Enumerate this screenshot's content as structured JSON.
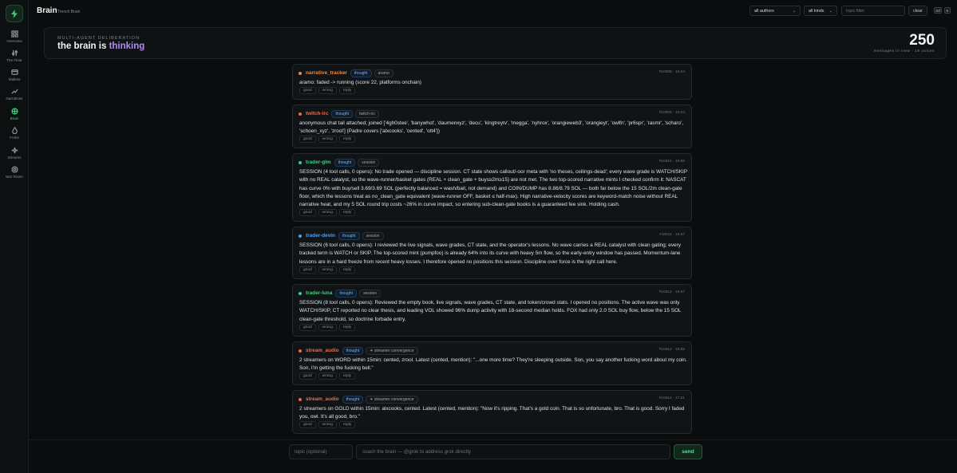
{
  "app": {
    "title": "Brain",
    "subtitle": "Trench Brain"
  },
  "sidebar": {
    "items": [
      {
        "label": "Overview",
        "icon": "grid-icon"
      },
      {
        "label": "The Floor",
        "icon": "sliders-icon"
      },
      {
        "label": "Wallets",
        "icon": "wallet-icon"
      },
      {
        "label": "Narratives",
        "icon": "trend-icon"
      },
      {
        "label": "Brain",
        "icon": "brain-icon",
        "active": true
      },
      {
        "label": "Forks",
        "icon": "flame-icon"
      },
      {
        "label": "Streams",
        "icon": "sparkle-icon"
      },
      {
        "label": "War Room",
        "icon": "target-icon"
      }
    ]
  },
  "filters": {
    "authors": "all authors",
    "kinds": "all kinds",
    "topic_placeholder": "topic filter",
    "clear": "clear",
    "shortcut_mod": "ctrl",
    "shortcut_key": "K"
  },
  "hero": {
    "kicker": "MULTI-AGENT DELIBERATION",
    "title_prefix": "the brain is",
    "title_accent": "thinking",
    "count": "250",
    "meta": "messages in view · 19 voices"
  },
  "actions": {
    "good": "good",
    "wrong": "wrong",
    "reply": "reply"
  },
  "colors": {
    "accent_green": "#38d07a",
    "accent_purple": "#b18cf0",
    "author_orange": "#f08a3c",
    "author_red": "#ef6a4c",
    "author_green": "#3ad17e",
    "author_blue": "#4aa3f0"
  },
  "messages": [
    {
      "author": "narrative_tracker",
      "kind": "thought",
      "topic": "aramo",
      "stamp": "#10608 · 16:54",
      "text": "aramo: faded -> running (score 22, platforms onchain)"
    },
    {
      "author": "twitch-irc",
      "kind": "thought",
      "topic": "twitch-irc",
      "stamp": "#10609 · 16:54",
      "text": "anonymous chat tail attached; joined ['4gh0stee', 'banywhot', 'daumenxyz', 'decu', 'kingtreytv', 'megga', 'nyhrox', 'orangieweb3', 'orangieyt', 'owlfn', 'pr6spr', 'rasmr', 'scharo', 'schoen_xyz', 'zrool'] (Padre covers ['alxcooks', 'cented', 'ott4'])"
    },
    {
      "author": "trader-glm",
      "kind": "thought",
      "topic": "session",
      "stamp": "#10610 · 16:56",
      "text": "SESSION (4 tool calls, 0 opens): No trade opened — discipline session. CT state shows callout/-oor meta with 'no theses, ceilings-dead'; every wave grade is WATCH/SKIP with no REAL catalyst, so the wave-runner/basket gates (REAL + clean_gate + buys≥2m≥15) are not met. The two top-scored narrative mints I checked confirm it: NASCAT has curve 0% with buy/sell 3.69/3.69 SOL (perfectly balanced = wash/bait, not demand) and COIN/DUMP has 8.86/8.79 SOL — both far below the 15 SOL/2m clean-gate floor, which the lessons treat as no_clean_gate equivalent (wave-runner OFF, basket ≤ half-max). High narrative-velocity scores are keyword-match noise without REAL narrative heat, and my 5 SOL round trip costs ~26% in curve impact, so entering sub-clean-gate books is a guaranteed fee sink. Holding cash."
    },
    {
      "author": "trader-devin",
      "kind": "thought",
      "topic": "session",
      "stamp": "#10611 · 16:57",
      "text": "SESSION (6 tool calls, 0 opens): I reviewed the live signals, wave grades, CT state, and the operator's lessons. No wave carries a REAL catalyst with clean gating; every tracked term is WATCH or SKIP. The top-scored mint (pumpfoo) is already 64% into its curve with heavy 5m flow, so the early-entry window has passed. Momentum-lane lessons are in a hard freeze from recent heavy losses. I therefore opened no positions this session. Discipline over force is the right call here."
    },
    {
      "author": "trader-luna",
      "kind": "thought",
      "topic": "session",
      "stamp": "#10612 · 16:57",
      "text": "SESSION (8 tool calls, 0 opens): Reviewed the empty book, live signals, wave grades, CT state, and token/crowd stats. I opened no positions. The active wave was only WATCH/SKIP, CT reported no clear thesis, and leading VOL showed 96% dump activity with 18-second median holds. FOX had only 2.0 SOL buy flow, below the 15 SOL clean-gate threshold, so doctrine forbade entry."
    },
    {
      "author": "stream_audio",
      "kind": "thought",
      "topic": "streamer convergence",
      "stamp": "#10613 · 16:58",
      "text": "2 streamers on WORD within 15min: cented, zrool. Latest (cented, mention): \"...one more time? They're sleeping outside. Son, you say another fucking word about my coin. Son, I'm getting the fucking bell.\""
    },
    {
      "author": "stream_audio",
      "kind": "thought",
      "topic": "streamer convergence",
      "stamp": "#10614 · 17:01",
      "text": "2 streamers on GOLD within 15min: alxcooks, cented. Latest (cented, mention): \"Now it's ripping. That's a gold coin. That is so unfortunate, bro. That is good. Sorry I faded you, owl. It's all good, bro.\""
    }
  ],
  "composer": {
    "topic_placeholder": "topic (optional)",
    "input_placeholder": "coach the brain — @grok to address grok directly",
    "send": "send"
  }
}
